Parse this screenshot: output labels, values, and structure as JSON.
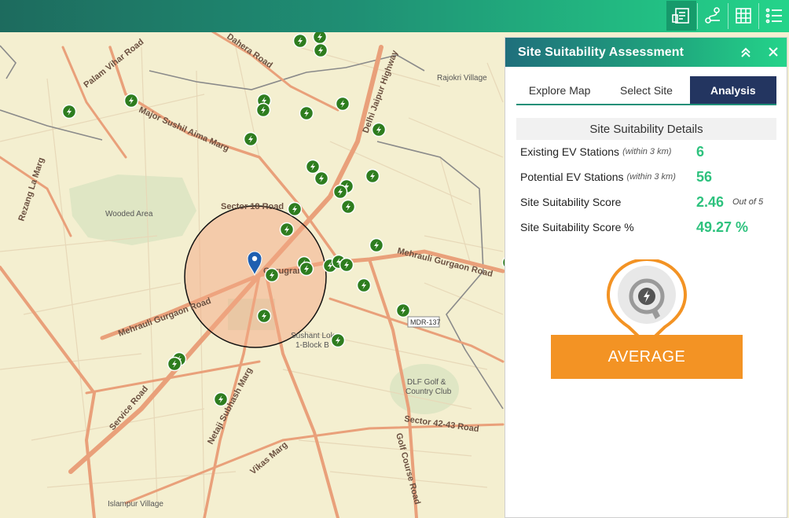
{
  "toolbar": {
    "buttons": [
      {
        "icon": "report-icon",
        "active": true
      },
      {
        "icon": "route-icon",
        "active": false
      },
      {
        "icon": "grid-icon",
        "active": false
      },
      {
        "icon": "list-icon",
        "active": false
      }
    ]
  },
  "map": {
    "labels": {
      "palam_vihar": "Palam Vihar Road",
      "major_sushil": "Major Sushil Aima Marg",
      "dahera": "Dahera Road",
      "rajokri": "Rajokri Village",
      "delhi_jaipur": "Delhi Jaipur Highway",
      "rezang": "Rezang La Marg",
      "wooded": "Wooded Area",
      "sector18": "Sector 18 Road",
      "gurugram": "Gurugram",
      "mehrauli_right": "Mehrauli Gurgaon Road",
      "mehrauli_left": "Mehrauli Gurgaon Road",
      "mdr": "MDR-137",
      "sushant": "Sushant Lok",
      "block": "1-Block B",
      "dlf_golf_1": "DLF Golf &",
      "dlf_golf_2": "Country Club",
      "sector42": "Sector 42-43 Road",
      "service": "Service Road",
      "netaji": "Netaji Subhash Marg",
      "golf_course": "Golf Course Road",
      "vikas": "Vikas Marg",
      "islampur": "Islampur Village"
    },
    "search_radius_km": 3
  },
  "panel": {
    "title": "Site Suitability Assessment",
    "tabs": [
      {
        "label": "Explore Map",
        "active": false
      },
      {
        "label": "Select Site",
        "active": false
      },
      {
        "label": "Analysis",
        "active": true
      }
    ],
    "details_title": "Site Suitability Details",
    "rows": [
      {
        "label": "Existing EV Stations",
        "note": "(within 3 km)",
        "value": "6",
        "suffix": ""
      },
      {
        "label": "Potential EV Stations",
        "note": "(within 3 km)",
        "value": "56",
        "suffix": ""
      },
      {
        "label": "Site Suitability Score",
        "note": "",
        "value": "2.46",
        "suffix": "Out of 5"
      },
      {
        "label": "Site Suitability Score %",
        "note": "",
        "value": "49.27 %",
        "suffix": ""
      }
    ],
    "rating_label": "AVERAGE",
    "colors": {
      "accent": "#2ec27e",
      "rating": "#f39324",
      "tab_active": "#233560"
    }
  }
}
